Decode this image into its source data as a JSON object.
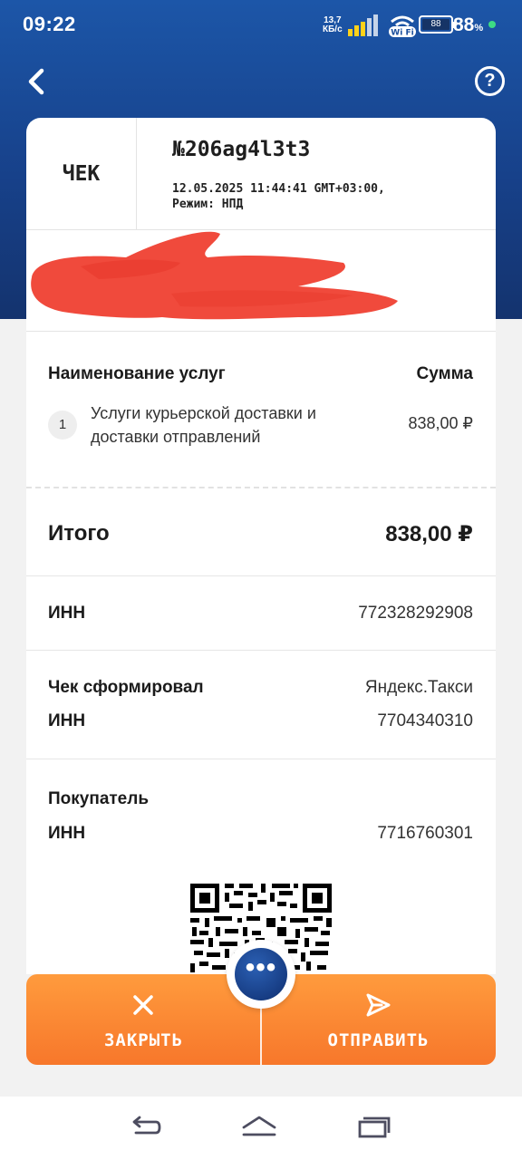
{
  "status_bar": {
    "time": "09:22",
    "net_speed_value": "13,7",
    "net_speed_unit": "КБ/с",
    "wifi_label": "Wi Fi",
    "battery_inner": "88",
    "battery_percent": "88",
    "percent_sign": "%"
  },
  "header": {
    "back_icon": "chevron-left-icon",
    "help_icon": "question-circle-icon",
    "help_glyph": "?"
  },
  "receipt": {
    "kind": "ЧЕК",
    "number": "№206ag4l3t3",
    "datetime": "12.05.2025 11:44:41 GMT+03:00,",
    "mode": "Режим: НПД",
    "items_header": "Наименование услуг",
    "sum_header": "Сумма",
    "items": [
      {
        "index": "1",
        "name": "Услуги курьерской доставки и доставки отправлений",
        "price": "838,00 ₽"
      }
    ],
    "total_label": "Итого",
    "total_value": "838,00 ₽",
    "inn_label": "ИНН",
    "inn_value": "772328292908",
    "issuer_label": "Чек сформировал",
    "issuer_value": "Яндекс.Такси",
    "issuer_inn_label": "ИНН",
    "issuer_inn_value": "7704340310",
    "buyer_label": "Покупатель",
    "buyer_inn_label": "ИНН",
    "buyer_inn_value": "7716760301"
  },
  "actions": {
    "close_label": "ЗАКРЫТЬ",
    "close_icon": "close-icon",
    "send_label": "ОТПРАВИТЬ",
    "send_icon": "send-icon",
    "more_glyph": "•••"
  },
  "colors": {
    "header_blue": "#1a4e9c",
    "action_orange": "#f7822f",
    "redaction_red": "#f04a3c"
  }
}
